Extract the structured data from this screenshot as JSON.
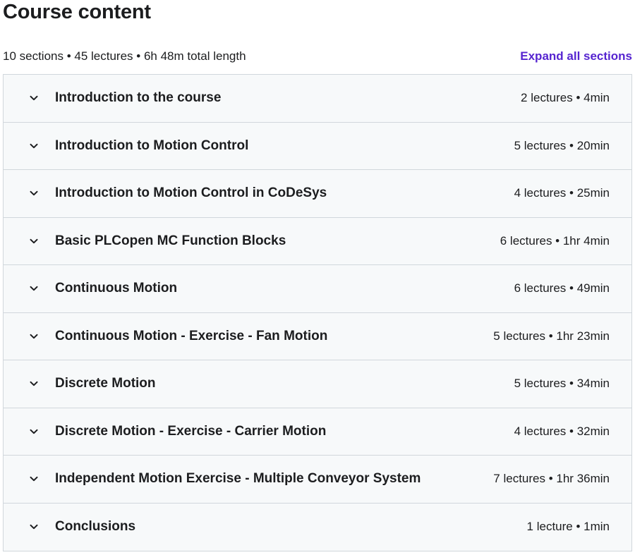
{
  "header": {
    "title": "Course content",
    "summary": "10 sections • 45 lectures • 6h 48m total length",
    "expand_label": "Expand all sections"
  },
  "colors": {
    "link": "#5624d0",
    "section_bg": "#f7f9fa",
    "border": "#d1d7dc",
    "text": "#1c1d1f"
  },
  "sections": [
    {
      "title": "Introduction to the course",
      "meta": "2 lectures • 4min",
      "icon": "chevron-down-icon"
    },
    {
      "title": "Introduction to Motion Control",
      "meta": "5 lectures • 20min",
      "icon": "chevron-down-icon"
    },
    {
      "title": "Introduction to Motion Control in CoDeSys",
      "meta": "4 lectures • 25min",
      "icon": "chevron-down-icon"
    },
    {
      "title": "Basic PLCopen MC Function Blocks",
      "meta": "6 lectures • 1hr 4min",
      "icon": "chevron-down-icon"
    },
    {
      "title": "Continuous Motion",
      "meta": "6 lectures • 49min",
      "icon": "chevron-down-icon"
    },
    {
      "title": "Continuous Motion - Exercise - Fan Motion",
      "meta": "5 lectures • 1hr 23min",
      "icon": "chevron-down-icon"
    },
    {
      "title": "Discrete Motion",
      "meta": "5 lectures • 34min",
      "icon": "chevron-down-icon"
    },
    {
      "title": "Discrete Motion - Exercise - Carrier Motion",
      "meta": "4 lectures • 32min",
      "icon": "chevron-down-icon"
    },
    {
      "title": "Independent Motion Exercise - Multiple Conveyor System",
      "meta": "7 lectures • 1hr 36min",
      "icon": "chevron-down-icon"
    },
    {
      "title": "Conclusions",
      "meta": "1 lecture • 1min",
      "icon": "chevron-down-icon"
    }
  ]
}
